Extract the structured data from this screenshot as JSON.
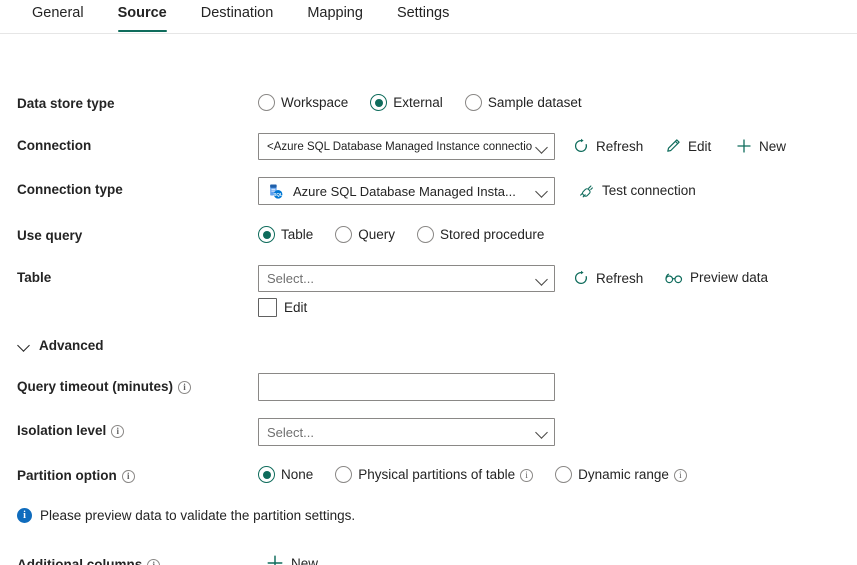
{
  "theme": {
    "accent": "#0f6c5c",
    "info_blue": "#0f6cbd",
    "text": "#242424",
    "border": "#8a8886"
  },
  "tabs": [
    {
      "label": "General",
      "active": false
    },
    {
      "label": "Source",
      "active": true
    },
    {
      "label": "Destination",
      "active": false
    },
    {
      "label": "Mapping",
      "active": false
    },
    {
      "label": "Settings",
      "active": false
    }
  ],
  "form": {
    "data_store_type": {
      "label": "Data store type",
      "options": [
        {
          "label": "Workspace",
          "selected": false
        },
        {
          "label": "External",
          "selected": true
        },
        {
          "label": "Sample dataset",
          "selected": false
        }
      ]
    },
    "connection": {
      "label": "Connection",
      "value": "<Azure SQL Database Managed Instance connection>",
      "actions": [
        {
          "label": "Refresh",
          "icon": "refresh-icon"
        },
        {
          "label": "Edit",
          "icon": "pencil-icon"
        },
        {
          "label": "New",
          "icon": "plus-icon"
        }
      ]
    },
    "connection_type": {
      "label": "Connection type",
      "value": "Azure SQL Database Managed Insta...",
      "icon": "azure-sql-database-icon",
      "action": {
        "label": "Test connection",
        "icon": "plug-icon"
      }
    },
    "use_query": {
      "label": "Use query",
      "options": [
        {
          "label": "Table",
          "selected": true
        },
        {
          "label": "Query",
          "selected": false
        },
        {
          "label": "Stored procedure",
          "selected": false
        }
      ]
    },
    "table": {
      "label": "Table",
      "placeholder": "Select...",
      "value": "",
      "edit_checkbox": {
        "label": "Edit",
        "checked": false
      },
      "actions": [
        {
          "label": "Refresh",
          "icon": "refresh-icon"
        },
        {
          "label": "Preview data",
          "icon": "glasses-icon"
        }
      ]
    },
    "advanced": {
      "label": "Advanced",
      "expanded": true
    },
    "query_timeout": {
      "label": "Query timeout (minutes)",
      "has_info": true,
      "value": "",
      "placeholder": ""
    },
    "isolation_level": {
      "label": "Isolation level",
      "has_info": true,
      "placeholder": "Select...",
      "value": ""
    },
    "partition_option": {
      "label": "Partition option",
      "has_info": true,
      "options": [
        {
          "label": "None",
          "selected": true,
          "has_info": false
        },
        {
          "label": "Physical partitions of table",
          "selected": false,
          "has_info": true
        },
        {
          "label": "Dynamic range",
          "selected": false,
          "has_info": true
        }
      ]
    },
    "partition_message": "Please preview data to validate the partition settings.",
    "additional_columns": {
      "label": "Additional columns",
      "has_info": true,
      "action": {
        "label": "New",
        "icon": "plus-icon"
      }
    }
  }
}
